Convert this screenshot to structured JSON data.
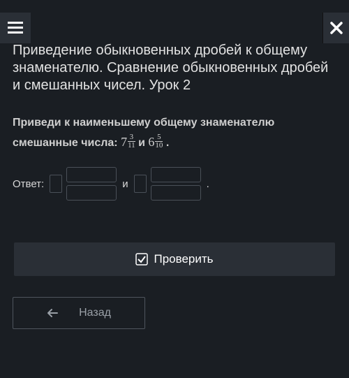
{
  "header": {
    "menu_icon": "hamburger",
    "close_icon": "close"
  },
  "lesson_title": "Приведение обыкновенных дробей к общему знаменателю. Сравнение обыкновенных дробей и смешанных чисел. Урок 2",
  "task": {
    "prefix": "Приведи к наименьшему общему знаменателю смешанные числа:",
    "mixed1": {
      "whole": "7",
      "num": "3",
      "den": "11"
    },
    "conj": "и",
    "mixed2": {
      "whole": "6",
      "num": "5",
      "den": "10"
    },
    "suffix": "."
  },
  "answer": {
    "label": "Ответ:",
    "separator": "и",
    "period": "."
  },
  "buttons": {
    "check": "Проверить",
    "back": "Назад"
  }
}
